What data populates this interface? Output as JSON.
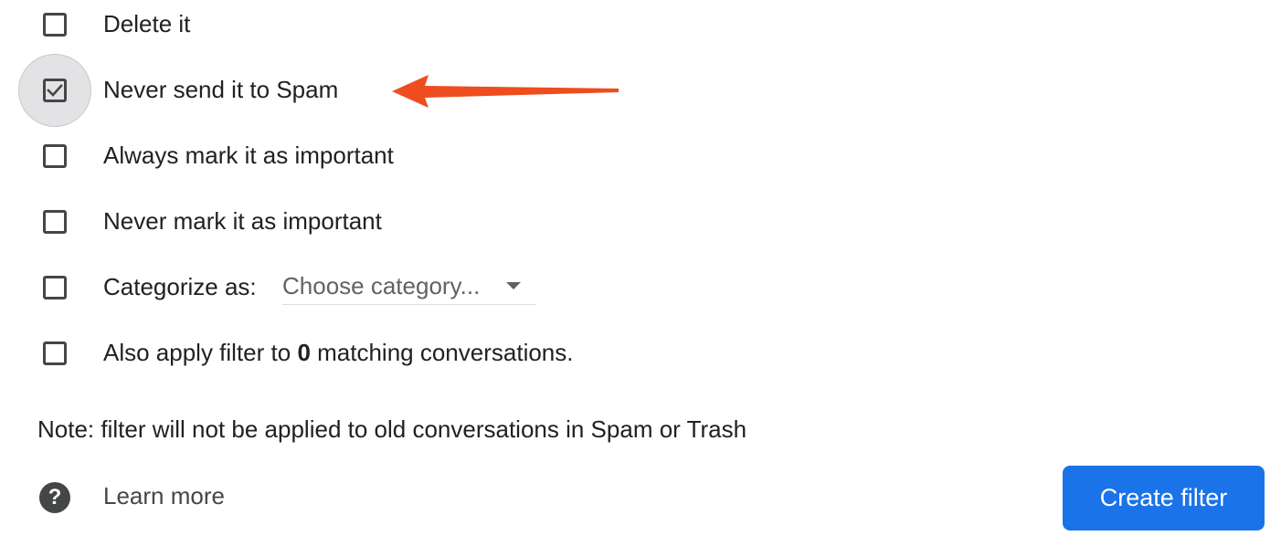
{
  "options": [
    {
      "label": "Delete it",
      "checked": false
    },
    {
      "label": "Never send it to Spam",
      "checked": true
    },
    {
      "label": "Always mark it as important",
      "checked": false
    },
    {
      "label": "Never mark it as important",
      "checked": false
    },
    {
      "label": "Categorize as:",
      "checked": false
    },
    {
      "label_prefix": "Also apply filter to ",
      "count": "0",
      "label_suffix": " matching conversations.",
      "checked": false
    }
  ],
  "category_select": {
    "value": "Choose category..."
  },
  "note": "Note: filter will not be applied to old conversations in Spam or Trash",
  "help": {
    "icon": "question-circle-icon",
    "glyph": "?",
    "link_label": "Learn more"
  },
  "create_button": {
    "label": "Create filter"
  },
  "annotation": {
    "arrow_color": "#ee4d1f"
  },
  "colors": {
    "accent": "#1a73e8",
    "checkbox_border": "#444746",
    "focus_halo": "#e3e3e5"
  }
}
